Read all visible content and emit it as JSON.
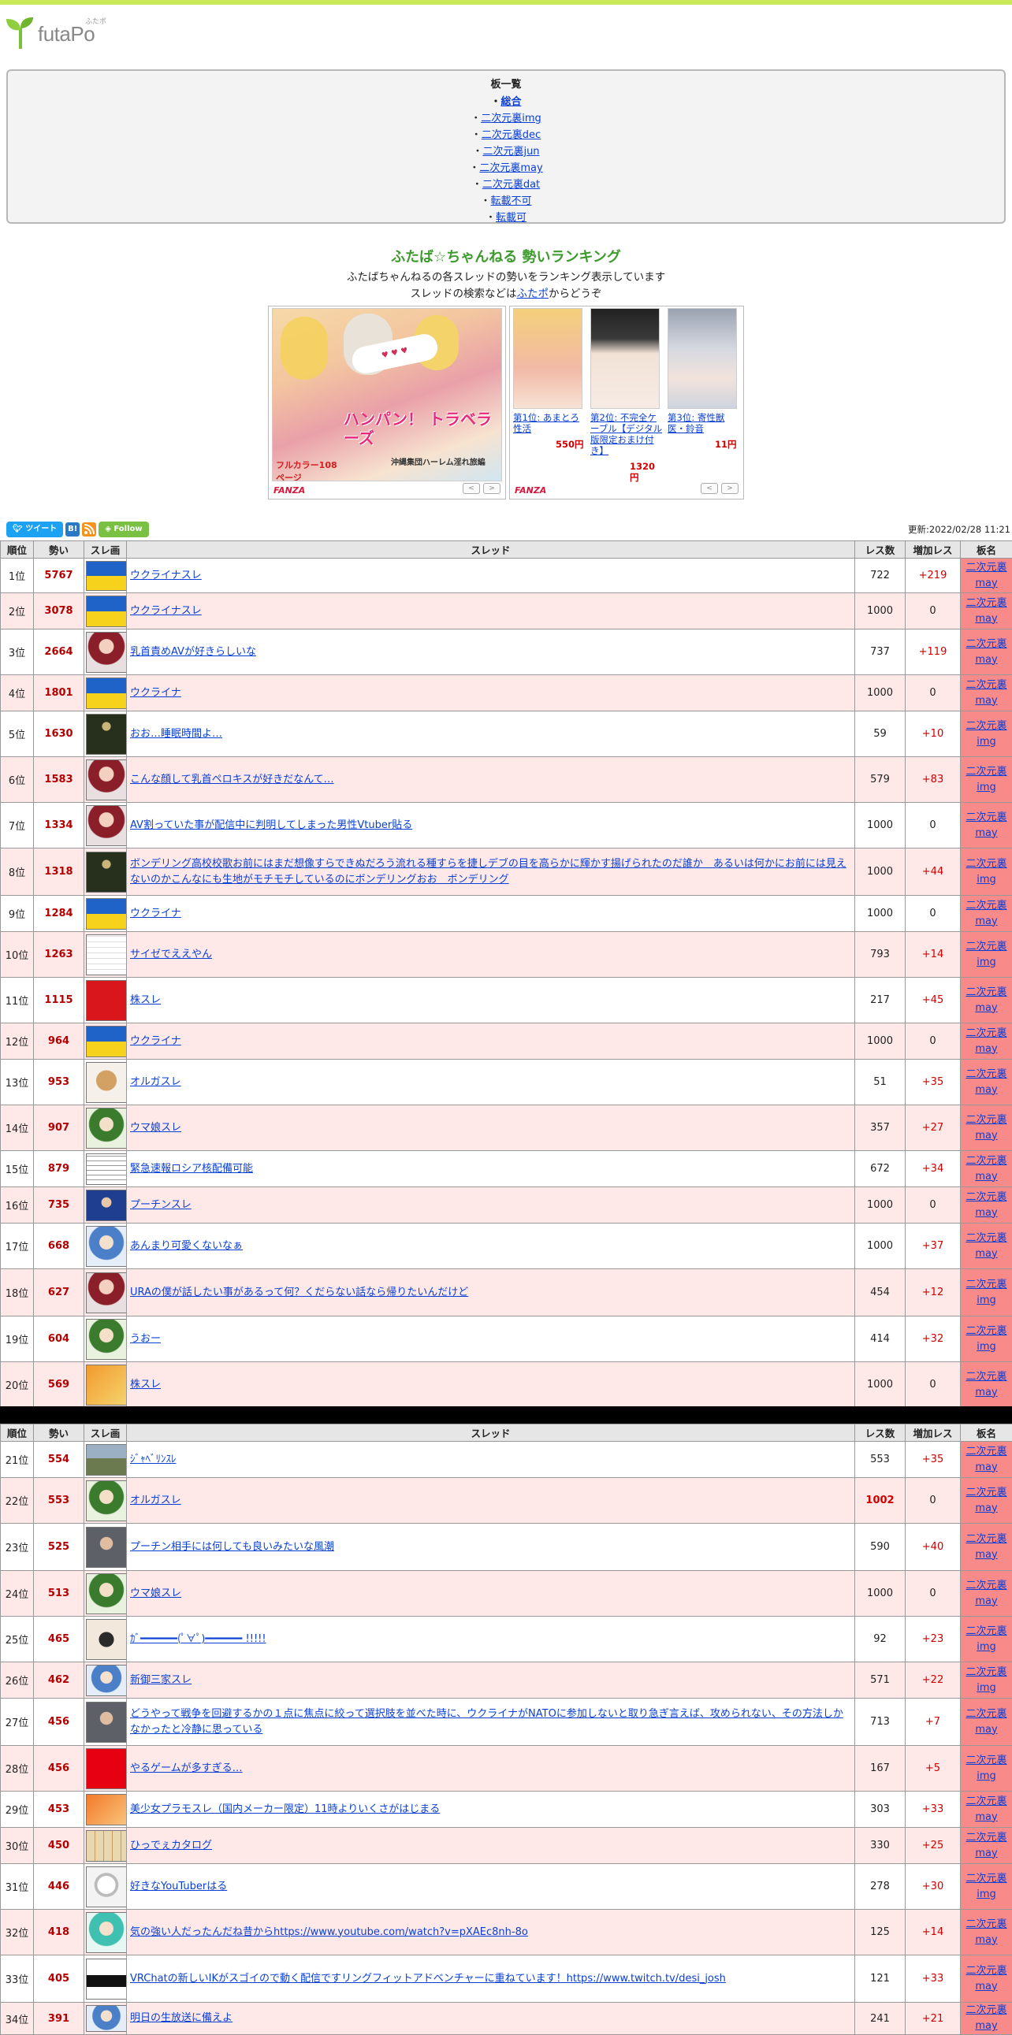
{
  "site": {
    "logo_text": "futaPo",
    "logo_ruby": "ふたポ"
  },
  "boards": {
    "heading": "板一覧",
    "items": [
      {
        "label": "総合",
        "active": true
      },
      {
        "label": "二次元裏img"
      },
      {
        "label": "二次元裏dec"
      },
      {
        "label": "二次元裏jun"
      },
      {
        "label": "二次元裏may"
      },
      {
        "label": "二次元裏dat"
      },
      {
        "label": "転載不可"
      },
      {
        "label": "転載可"
      },
      {
        "label": "..."
      }
    ]
  },
  "header": {
    "title": "ふたば☆ちゃんねる 勢いランキング",
    "intro_line1": "ふたばちゃんねるの各スレッドの勢いをランキング表示しています",
    "intro_line2_pre": "スレッドの検索などは",
    "intro_line2_link": "ふたポ",
    "intro_line2_post": "からどうぞ"
  },
  "ads": {
    "ad1": {
      "caption_big": "ハンパン！ トラベラーズ",
      "caption_sub": "沖縄集団ハーレム淫れ旅編",
      "pages": "フルカラー108ページ",
      "brand": "FANZA"
    },
    "ad2": {
      "brand": "FANZA",
      "items": [
        {
          "name": "第1位: あまとろ性活",
          "price": "550円"
        },
        {
          "name": "第2位: 不完全ケーブル【デジタル版限定おまけ付き】",
          "price": "1320円"
        },
        {
          "name": "第3位: 寄性獣医・鈴音",
          "price": "11円"
        }
      ]
    }
  },
  "social": {
    "tweet": "ツイート",
    "hatena": "B!",
    "follow": "Follow"
  },
  "updated": "更新:2022/02/28 11:21",
  "columns": [
    "順位",
    "勢い",
    "スレ画",
    "スレッド",
    "レス数",
    "増加レス",
    "板名"
  ],
  "rows1": [
    {
      "rank": "1位",
      "ikioi": "5767",
      "title": "ウクライナスレ",
      "res": "722",
      "inc": "+219",
      "board": "二次元裏may",
      "thumb": "ukraine"
    },
    {
      "rank": "2位",
      "ikioi": "3078",
      "title": "ウクライナスレ",
      "res": "1000",
      "inc": "0",
      "board": "二次元裏may",
      "thumb": "ukraine"
    },
    {
      "rank": "3位",
      "ikioi": "2664",
      "title": "乳首責めAVが好きらしいな",
      "res": "737",
      "inc": "+119",
      "board": "二次元裏may",
      "thumb": "anime-red"
    },
    {
      "rank": "4位",
      "ikioi": "1801",
      "title": "ウクライナ",
      "res": "1000",
      "inc": "0",
      "board": "二次元裏may",
      "thumb": "ukraine"
    },
    {
      "rank": "5位",
      "ikioi": "1630",
      "title": "おお…睡眠時間よ…",
      "res": "59",
      "inc": "+10",
      "board": "二次元裏img",
      "thumb": "dark-game"
    },
    {
      "rank": "6位",
      "ikioi": "1583",
      "title": "こんな顔して乳首ペロキスが好きだなんて…",
      "res": "579",
      "inc": "+83",
      "board": "二次元裏img",
      "thumb": "anime-red"
    },
    {
      "rank": "7位",
      "ikioi": "1334",
      "title": "AV割っていた事が配信中に判明してしまった男性Vtuber貼る",
      "res": "1000",
      "inc": "0",
      "board": "二次元裏may",
      "thumb": "anime-red"
    },
    {
      "rank": "8位",
      "ikioi": "1318",
      "title": "ボンデリング高校校歌お前にはまだ想像すらできぬだろう流れる種すらを捷しデブの目を高らかに輝かす揚げられたのだ誰か　あるいは何かにお前には見えないのかこんなにも生地がモチモチしているのにボンデリングおお　ボンデリング",
      "res": "1000",
      "inc": "+44",
      "board": "二次元裏img",
      "thumb": "dark-game"
    },
    {
      "rank": "9位",
      "ikioi": "1284",
      "title": "ウクライナ",
      "res": "1000",
      "inc": "0",
      "board": "二次元裏may",
      "thumb": "ukraine"
    },
    {
      "rank": "10位",
      "ikioi": "1263",
      "title": "サイゼでええやん",
      "res": "793",
      "inc": "+14",
      "board": "二次元裏img",
      "thumb": "manga"
    },
    {
      "rank": "11位",
      "ikioi": "1115",
      "title": "株スレ",
      "res": "217",
      "inc": "+45",
      "board": "二次元裏may",
      "thumb": "news-red"
    },
    {
      "rank": "12位",
      "ikioi": "964",
      "title": "ウクライナ",
      "res": "1000",
      "inc": "0",
      "board": "二次元裏may",
      "thumb": "ukraine"
    },
    {
      "rank": "13位",
      "ikioi": "953",
      "title": "オルガスレ",
      "res": "51",
      "inc": "+35",
      "board": "二次元裏may",
      "thumb": "dog"
    },
    {
      "rank": "14位",
      "ikioi": "907",
      "title": "ウマ娘スレ",
      "res": "357",
      "inc": "+27",
      "board": "二次元裏may",
      "thumb": "anime-green"
    },
    {
      "rank": "15位",
      "ikioi": "879",
      "title": "緊急速報ロシア核配備可能",
      "res": "672",
      "inc": "+34",
      "board": "二次元裏may",
      "thumb": "text"
    },
    {
      "rank": "16位",
      "ikioi": "735",
      "title": "プーチンスレ",
      "res": "1000",
      "inc": "0",
      "board": "二次元裏may",
      "thumb": "person-blue"
    },
    {
      "rank": "17位",
      "ikioi": "668",
      "title": "あんまり可愛くないなぁ",
      "res": "1000",
      "inc": "+37",
      "board": "二次元裏may",
      "thumb": "anime-blue"
    },
    {
      "rank": "18位",
      "ikioi": "627",
      "title": "URAの僕が話したい事があるって何？くだらない話なら帰りたいんだけど",
      "res": "454",
      "inc": "+12",
      "board": "二次元裏img",
      "thumb": "anime-red"
    },
    {
      "rank": "19位",
      "ikioi": "604",
      "title": "うおー",
      "res": "414",
      "inc": "+32",
      "board": "二次元裏img",
      "thumb": "anime-green"
    },
    {
      "rank": "20位",
      "ikioi": "569",
      "title": "株スレ",
      "res": "1000",
      "inc": "0",
      "board": "二次元裏may",
      "thumb": "news-orange"
    }
  ],
  "rows2": [
    {
      "rank": "21位",
      "ikioi": "554",
      "title": "ｼﾞｬﾍﾞﾘﾝｽﾚ",
      "res": "553",
      "inc": "+35",
      "board": "二次元裏may",
      "thumb": "tank"
    },
    {
      "rank": "22位",
      "ikioi": "553",
      "title": "オルガスレ",
      "res": "1002",
      "inc": "0",
      "board": "二次元裏may",
      "thumb": "anime-green"
    },
    {
      "rank": "23位",
      "ikioi": "525",
      "title": "プーチン相手には何しても良いみたいな風潮",
      "res": "590",
      "inc": "+40",
      "board": "二次元裏may",
      "thumb": "person-gray"
    },
    {
      "rank": "24位",
      "ikioi": "513",
      "title": "ウマ娘スレ",
      "res": "1000",
      "inc": "0",
      "board": "二次元裏may",
      "thumb": "anime-green"
    },
    {
      "rank": "25位",
      "ikioi": "465",
      "title": "ｶﾞ━━━━━━(ﾟ∀ﾟ)━━━━━━ !!!!!",
      "res": "92",
      "inc": "+23",
      "board": "二次元裏img",
      "thumb": "cartoon"
    },
    {
      "rank": "26位",
      "ikioi": "462",
      "title": "新御三家スレ",
      "res": "571",
      "inc": "+22",
      "board": "二次元裏img",
      "thumb": "anime-blue"
    },
    {
      "rank": "27位",
      "ikioi": "456",
      "title": "どうやって戦争を回避するかの１点に焦点に絞って選択肢を並べた時に、ウクライナがNATOに参加しないと取り急ぎ言えば、攻められない、その方法しかなかったと冷静に思っている",
      "res": "713",
      "inc": "+7",
      "board": "二次元裏may",
      "thumb": "person-gray"
    },
    {
      "rank": "28位",
      "ikioi": "456",
      "title": "やるゲームが多すぎる…",
      "res": "167",
      "inc": "+5",
      "board": "二次元裏img",
      "thumb": "switch"
    },
    {
      "rank": "29位",
      "ikioi": "453",
      "title": "美少女プラモスレ（国内メーカー限定）11時よりいくさがはじまる",
      "res": "303",
      "inc": "+33",
      "board": "二次元裏may",
      "thumb": "orange"
    },
    {
      "rank": "30位",
      "ikioi": "450",
      "title": "ひっでぇカタログ",
      "res": "330",
      "inc": "+25",
      "board": "二次元裏may",
      "thumb": "catalog"
    },
    {
      "rank": "31位",
      "ikioi": "446",
      "title": "好きなYouTuberはる",
      "res": "278",
      "inc": "+30",
      "board": "二次元裏img",
      "thumb": "sketch"
    },
    {
      "rank": "32位",
      "ikioi": "418",
      "title": "気の強い人だったんだね昔からhttps://www.youtube.com/watch?v=pXAEc8nh-8o",
      "res": "125",
      "inc": "+14",
      "board": "二次元裏may",
      "thumb": "anime-teal"
    },
    {
      "rank": "33位",
      "ikioi": "405",
      "title": "VRChatの新しいIKがスゴイので動く配信ですリングフィットアドベンチャーに重ねています！https://www.twitch.tv/desi_josh",
      "res": "121",
      "inc": "+33",
      "board": "二次元裏may",
      "thumb": "vrchat"
    },
    {
      "rank": "34位",
      "ikioi": "391",
      "title": "明日の生放送に備えよ",
      "res": "241",
      "inc": "+21",
      "board": "二次元裏may",
      "thumb": "anime-blue"
    }
  ]
}
